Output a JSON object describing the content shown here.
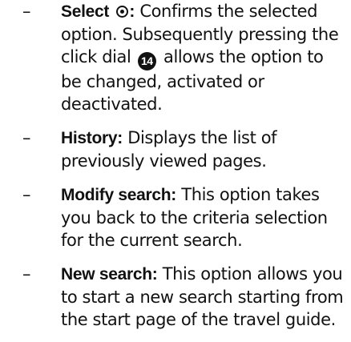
{
  "items": [
    {
      "dash": "–",
      "term": "Select",
      "term_suffix": ":",
      "text_before_badge": " Confirms the selected option. Subsequently pressing the click dial ",
      "badge": "14",
      "text_after_badge": " allows the option to be changed, activated or deactivated."
    },
    {
      "dash": "–",
      "term": "History:",
      "text": " Displays the list of previously viewed pages."
    },
    {
      "dash": "–",
      "term": "Modify search:",
      "text": " This option takes you back to the criteria selection for the current search."
    },
    {
      "dash": "–",
      "term": "New search:",
      "text": " This option allows you to start a new search starting from the start page of the travel guide."
    }
  ]
}
